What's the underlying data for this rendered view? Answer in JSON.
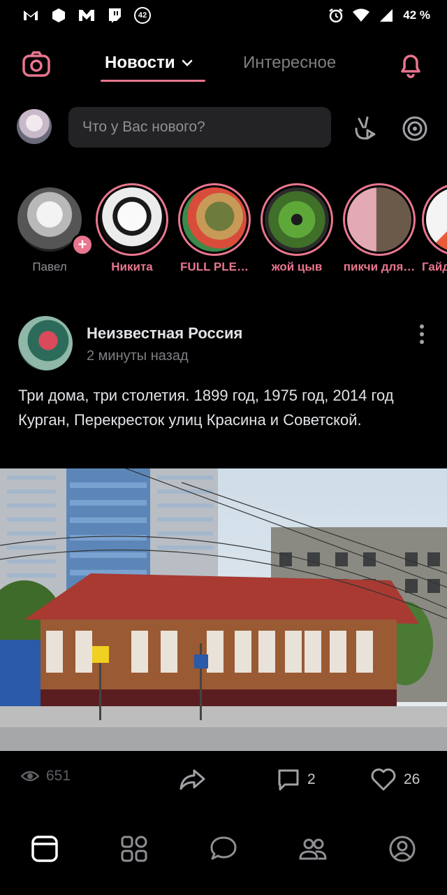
{
  "status_bar": {
    "left_icons": [
      "gmail-icon",
      "hexagon-app-icon",
      "m-app-icon",
      "twitch-icon",
      "notification-count-icon"
    ],
    "notification_count": "42",
    "right_icons": [
      "alarm-icon",
      "wifi-icon",
      "signal-icon"
    ],
    "battery": "42 %"
  },
  "top_nav": {
    "tabs": [
      {
        "label": "Новости",
        "active": true
      },
      {
        "label": "Интересное",
        "active": false
      }
    ]
  },
  "composer": {
    "placeholder": "Что у Вас нового?"
  },
  "stories": [
    {
      "name": "Павел",
      "own": true
    },
    {
      "name": "Никита",
      "own": false
    },
    {
      "name": "FULL PLE…",
      "own": false
    },
    {
      "name": "жой цыв",
      "own": false
    },
    {
      "name": "пикчи для…",
      "own": false
    },
    {
      "name": "Гайд",
      "own": false
    }
  ],
  "post": {
    "author": "Неизвестная Россия",
    "time": "2 минуты назад",
    "text_line1": "Три дома, три столетия. 1899 год, 1975 год, 2014 год",
    "text_line2": "Курган, Перекресток улиц Красина и Советской.",
    "views": "651",
    "comments": "2",
    "likes": "26"
  },
  "colors": {
    "accent": "#e8768e",
    "background": "#000000",
    "input_bg": "#232325",
    "muted": "#7d7f82"
  }
}
